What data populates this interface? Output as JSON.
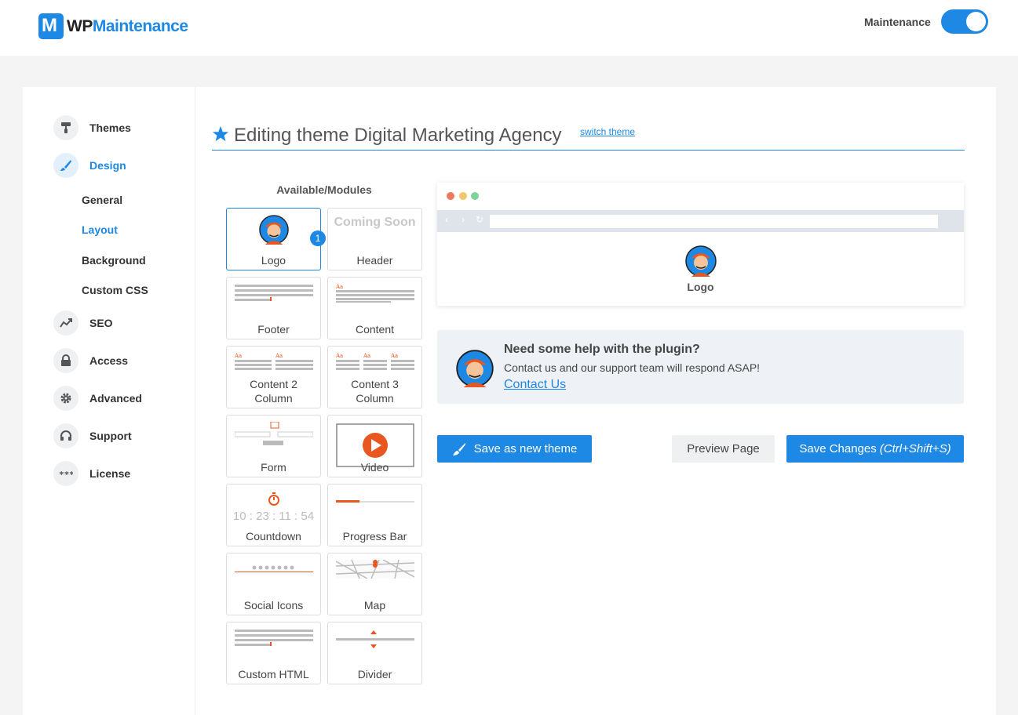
{
  "brand": {
    "logo_letter": "M",
    "name_prefix": "WP",
    "name_suffix": "Maintenance",
    "accent": "#1e88e5"
  },
  "header": {
    "maintenance_label": "Maintenance",
    "maintenance_on": true
  },
  "sidebar": {
    "items": [
      {
        "label": "Themes",
        "icon": "paint-roller-icon"
      },
      {
        "label": "Design",
        "icon": "brush-icon",
        "active": true
      },
      {
        "label": "SEO",
        "icon": "trend-icon"
      },
      {
        "label": "Access",
        "icon": "lock-icon"
      },
      {
        "label": "Advanced",
        "icon": "gear-icon"
      },
      {
        "label": "Support",
        "icon": "headset-icon"
      },
      {
        "label": "License",
        "icon": "password-icon"
      }
    ],
    "design_subitems": [
      {
        "label": "General"
      },
      {
        "label": "Layout",
        "active": true
      },
      {
        "label": "Background"
      },
      {
        "label": "Custom CSS"
      }
    ]
  },
  "main": {
    "title": "Editing theme Digital Marketing Agency",
    "switch_link": "switch theme",
    "modules_heading": "Available/Modules",
    "selected_badge": "1",
    "modules": [
      {
        "label": "Logo"
      },
      {
        "label": "Header",
        "preview_text": "Coming Soon"
      },
      {
        "label": "Footer"
      },
      {
        "label": "Content"
      },
      {
        "label_line1": "Content 2",
        "label_line2": "Column"
      },
      {
        "label_line1": "Content 3",
        "label_line2": "Column"
      },
      {
        "label": "Form"
      },
      {
        "label": "Video"
      },
      {
        "label": "Countdown",
        "preview_text": "10 : 23 : 11 : 54"
      },
      {
        "label": "Progress Bar"
      },
      {
        "label": "Social Icons"
      },
      {
        "label": "Map"
      },
      {
        "label": "Custom HTML"
      },
      {
        "label": "Divider"
      }
    ]
  },
  "preview": {
    "logo_label": "Logo",
    "dot_colors": [
      "#ee7a5c",
      "#f2c66b",
      "#7bd49a"
    ]
  },
  "help": {
    "title": "Need some help with the plugin?",
    "text": "Contact us and our support team will respond ASAP!",
    "link": "Contact Us"
  },
  "actions": {
    "save_new": "Save as new theme",
    "preview": "Preview Page",
    "save": "Save Changes",
    "save_shortcut": "(Ctrl+Shift+S)"
  }
}
